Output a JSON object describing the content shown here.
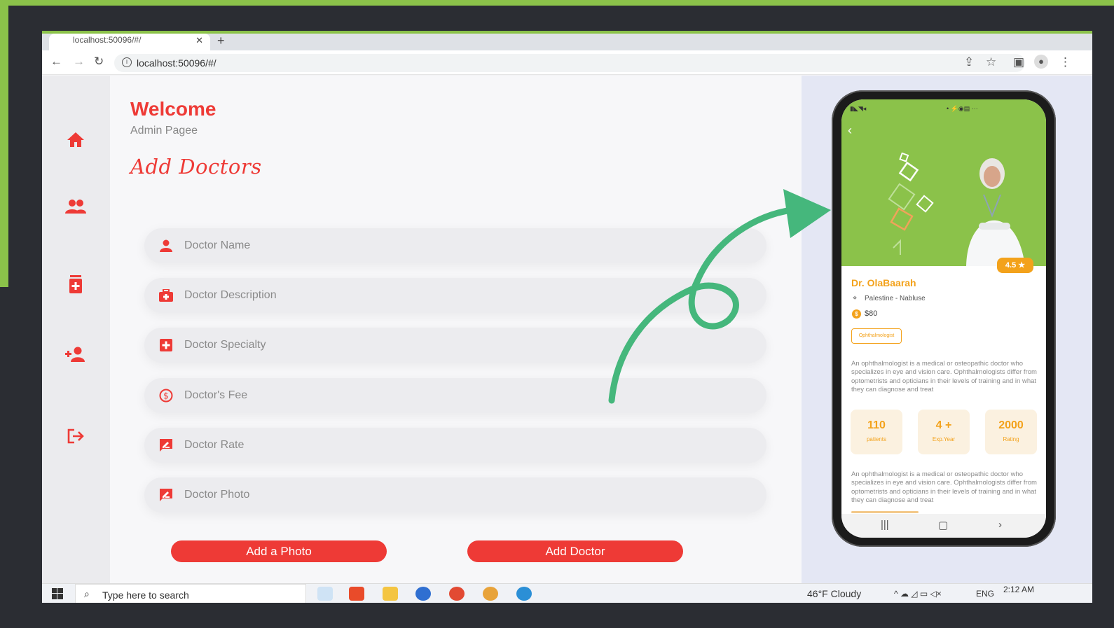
{
  "colors": {
    "accent": "#ee3a36",
    "brand_green": "#8bc24a",
    "orange": "#f3a21b",
    "arrow": "#45b77c"
  },
  "browser": {
    "tab_title": "localhost:50096/#/",
    "url": "localhost:50096/#/"
  },
  "sidebar": {
    "items": [
      {
        "icon": "home-icon"
      },
      {
        "icon": "people-icon"
      },
      {
        "icon": "medical-box-icon"
      },
      {
        "icon": "add-person-icon"
      },
      {
        "icon": "logout-icon"
      }
    ]
  },
  "header": {
    "title": "Welcome",
    "subtitle": "Admin Pagee"
  },
  "form": {
    "title": "Add Doctors",
    "fields": [
      {
        "placeholder": "Doctor Name",
        "value": "",
        "icon": "person-icon"
      },
      {
        "placeholder": "Doctor Description",
        "value": "",
        "icon": "medical-bag-icon"
      },
      {
        "placeholder": "Doctor Specialty",
        "value": "",
        "icon": "medical-cross-icon"
      },
      {
        "placeholder": "Doctor's Fee",
        "value": "",
        "icon": "dollar-icon"
      },
      {
        "placeholder": "Doctor Rate",
        "value": "",
        "icon": "rate-review-icon"
      },
      {
        "placeholder": "Doctor Photo",
        "value": "",
        "icon": "photo-review-icon"
      }
    ],
    "add_photo_label": "Add a Photo",
    "add_doctor_label": "Add Doctor"
  },
  "taskbar": {
    "search_placeholder": "Type here to search",
    "weather": "46°F Cloudy",
    "lang": "ENG",
    "time": "2:12 AM"
  },
  "phone": {
    "rating": "4.5 ★",
    "doctor_name": "Dr. OlaBaarah",
    "location": "Palestine - Nabluse",
    "fee": "$80",
    "specialty": "Ophthalmologist",
    "description": "An ophthalmologist is a medical or osteopathic doctor who specializes in eye and vision care. Ophthalmologists differ from optometrists and opticians in their levels of training and in what they can diagnose and treat",
    "stats": [
      {
        "value": "110",
        "label": "patients"
      },
      {
        "value": "4 +",
        "label": "Exp.Year"
      },
      {
        "value": "2000",
        "label": "Rating"
      }
    ]
  }
}
